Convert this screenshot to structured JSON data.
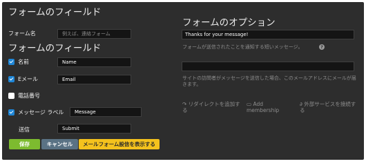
{
  "left": {
    "heading": "フォームのフィールド",
    "form_name_label": "フォーム名",
    "form_name_placeholder": "例えば、連絡フォーム",
    "fields_heading": "フォームのフィールド",
    "fields": [
      {
        "label": "名前",
        "checked": true,
        "value": "Name"
      },
      {
        "label": "Eメール",
        "checked": true,
        "value": "Email"
      },
      {
        "label": "電話番号",
        "checked": false,
        "value": ""
      },
      {
        "label": "メッセージ ラベル",
        "checked": true,
        "value": "Message"
      }
    ],
    "submit_label": "送信",
    "submit_value": "Submit"
  },
  "buttons": {
    "save": "保存",
    "cancel": "キャンセル",
    "show_mail_form": "メールフォーム設信を表示する"
  },
  "right": {
    "heading": "フォームのオプション",
    "message_value": "Thanks for your message!",
    "message_hint": "フォームが送信されたことを通知する短いメッセージ。",
    "help_icon_text": "?",
    "email_value": "",
    "email_hint": "サイトの訪問者がメッセージを送信した場合、このメールアドレスにメールが届きます。",
    "options": [
      {
        "icon": "redirect-icon",
        "glyph": "↷",
        "text": "リダイレクトを追加する"
      },
      {
        "icon": "membership-icon",
        "glyph": "▭",
        "text": "Add membership"
      },
      {
        "icon": "link-icon",
        "glyph": "∂",
        "text": "外部サービスを接続する"
      }
    ]
  },
  "colors": {
    "panel": "#2d2d2d",
    "save": "#7dbb2f",
    "cancel": "#5a7284",
    "show_mail_form": "#f4c21d",
    "checkbox": "#1f86d6"
  }
}
